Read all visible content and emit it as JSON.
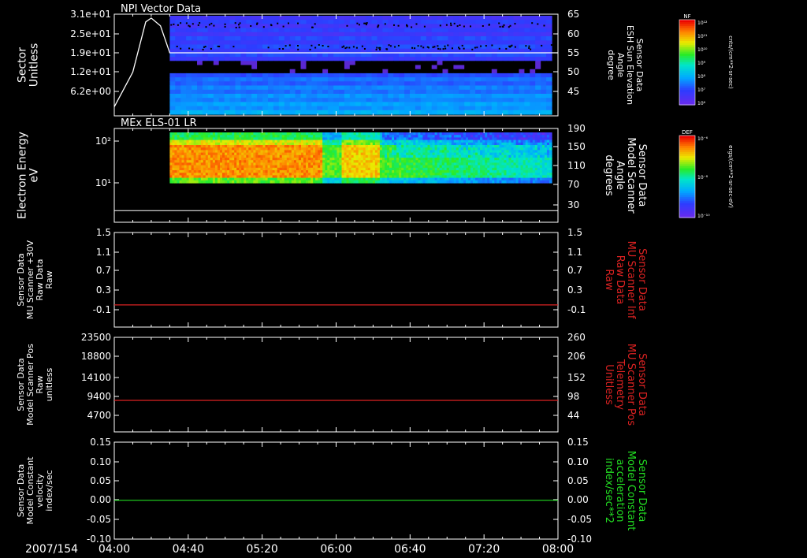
{
  "time_label": "2007/154",
  "x_ticks": [
    "04:00",
    "04:40",
    "05:20",
    "06:00",
    "06:40",
    "07:20",
    "08:00"
  ],
  "colors": {
    "background": "#000000",
    "frame": "#ffffff",
    "red_trace": "#dd2222",
    "green_trace": "#22dd22"
  },
  "panels": [
    {
      "title": "NPI Vector Data",
      "left_label": [
        "Sector",
        "Unitless"
      ],
      "left_ticks": [
        "3.1e+01",
        "2.5e+01",
        "1.9e+01",
        "1.2e+01",
        "6.2e+00"
      ],
      "right_label": [
        "Sensor Data",
        "ESH Sun Elevation",
        "Angle",
        "degree"
      ],
      "right_ticks": [
        "65",
        "60",
        "55",
        "50",
        "45"
      ],
      "right_label_color": "#ffffff"
    },
    {
      "title": "MEx ELS-01 LR",
      "left_label": [
        "Electron Energy",
        "eV"
      ],
      "left_ticks": [
        "10²",
        "10¹"
      ],
      "right_label": [
        "Sensor Data",
        "Model Scanner",
        "Angle",
        "degrees"
      ],
      "right_ticks": [
        "190",
        "150",
        "110",
        "70",
        "30"
      ],
      "right_label_color": "#ffffff"
    },
    {
      "title": "",
      "left_label": [
        "Sensor Data",
        "MU Scanner +30V",
        "Raw Data",
        "Raw"
      ],
      "left_ticks": [
        "1.5",
        "1.1",
        "0.7",
        "0.3",
        "-0.1"
      ],
      "right_label": [
        "Sensor Data",
        "MU Scanner Inf",
        "Raw Data",
        "Raw"
      ],
      "right_ticks": [
        "1.5",
        "1.1",
        "0.7",
        "0.3",
        "-0.1"
      ],
      "right_label_color": "#dd2222"
    },
    {
      "title": "",
      "left_label": [
        "Sensor Data",
        "Model Scanner Pos",
        "Raw",
        "unitless"
      ],
      "left_ticks": [
        "23500",
        "18800",
        "14100",
        "9400",
        "4700"
      ],
      "right_label": [
        "Sensor Data",
        "MU Scanner Pos",
        "Telemetry",
        "Unitless"
      ],
      "right_ticks": [
        "260",
        "206",
        "152",
        "98",
        "44"
      ],
      "right_label_color": "#dd2222"
    },
    {
      "title": "",
      "left_label": [
        "Sensor Data",
        "Model Constant",
        "velocity",
        "index/sec"
      ],
      "left_ticks": [
        "0.15",
        "0.10",
        "0.05",
        "0.00",
        "-0.05",
        "-0.10"
      ],
      "right_label": [
        "Sensor Data",
        "Model Constant",
        "acceleration",
        "index/sec**2"
      ],
      "right_ticks": [
        "0.15",
        "0.10",
        "0.05",
        "0.00",
        "-0.05",
        "-0.10"
      ],
      "right_label_color": "#22dd22"
    }
  ],
  "colorbars": [
    {
      "tag": "NF",
      "units": "cnts/(cm**2-sr-sec)",
      "ticks": [
        "10¹²",
        "10¹¹",
        "10¹⁰",
        "10⁹",
        "10⁸",
        "10⁷",
        "10⁶"
      ]
    },
    {
      "tag": "DEF",
      "units": "ergs/(cm**2-sr-sec-eV)",
      "ticks": [
        "10⁻⁶",
        "10⁻⁸",
        "10⁻¹⁰"
      ]
    }
  ],
  "chart_data": [
    {
      "type": "heatmap",
      "title": "NPI Vector Data",
      "x_range": [
        "04:00",
        "08:00"
      ],
      "data_start": "04:30",
      "y_label": "Sector Unitless",
      "y_ticks": [
        31,
        25,
        19,
        12,
        6.2
      ],
      "overlay_line": {
        "name": "ESH Sun Elevation Angle",
        "points": [
          [
            "04:00",
            41
          ],
          [
            "04:10",
            50
          ],
          [
            "04:17",
            63
          ],
          [
            "04:20",
            64
          ],
          [
            "04:25",
            62
          ],
          [
            "04:30",
            55
          ],
          [
            "08:00",
            55
          ]
        ]
      }
    },
    {
      "type": "heatmap",
      "title": "MEx ELS-01 LR",
      "x_range": [
        "04:00",
        "08:00"
      ],
      "data_start": "04:30",
      "y_label": "Electron Energy eV",
      "y_scale": "log",
      "overlay_line": {
        "name": "Model Scanner Angle",
        "points": [
          [
            "04:00",
            18
          ],
          [
            "08:00",
            18
          ]
        ]
      }
    },
    {
      "type": "line",
      "series": [
        {
          "name": "MU Scanner Inf Raw",
          "x": [
            "04:00",
            "08:00"
          ],
          "values": [
            0.0,
            0.0
          ]
        }
      ],
      "ylim": [
        -0.3,
        1.5
      ]
    },
    {
      "type": "line",
      "series": [
        {
          "name": "Model Scanner Pos Raw",
          "x": [
            "04:00",
            "08:00"
          ],
          "values": [
            8300,
            8300
          ]
        }
      ],
      "ylim": [
        0,
        23500
      ]
    },
    {
      "type": "line",
      "series": [
        {
          "name": "Model Constant velocity",
          "x": [
            "04:00",
            "08:00"
          ],
          "values": [
            0.0,
            0.0
          ]
        }
      ],
      "ylim": [
        -0.1,
        0.15
      ]
    }
  ]
}
